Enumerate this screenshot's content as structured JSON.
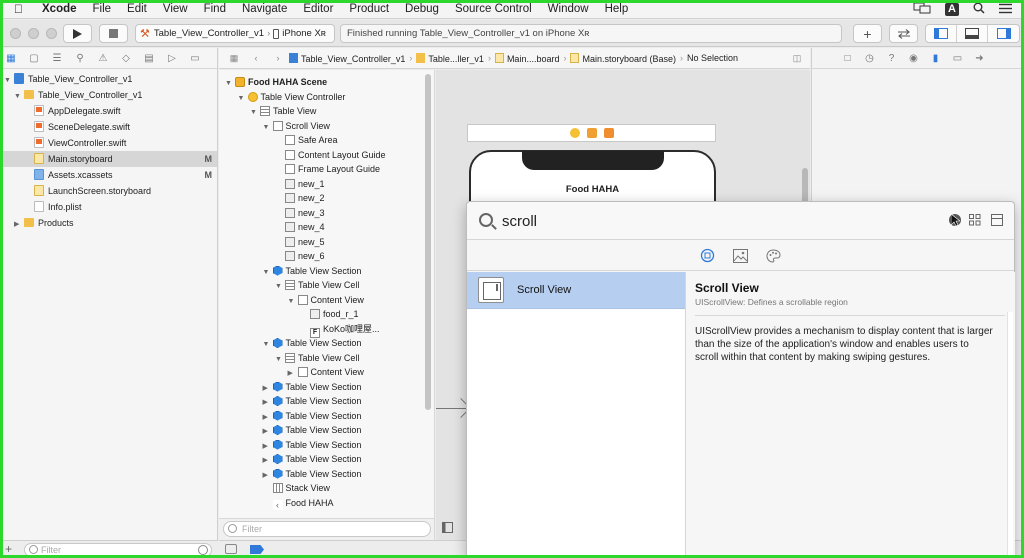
{
  "menubar": {
    "app": "Xcode",
    "items": [
      "File",
      "Edit",
      "View",
      "Find",
      "Navigate",
      "Editor",
      "Product",
      "Debug",
      "Source Control",
      "Window",
      "Help"
    ],
    "input_badge": "A"
  },
  "toolbar": {
    "scheme": "Table_View_Controller_v1",
    "destination": "iPhone Xʀ",
    "status": "Finished running Table_View_Controller_v1 on iPhone Xʀ"
  },
  "navigator": {
    "items": [
      {
        "label": "Table_View_Controller_v1",
        "mark": "",
        "icon": "project-icon"
      },
      {
        "label": "Table_View_Controller_v1",
        "mark": "",
        "icon": "folder-icon"
      },
      {
        "label": "AppDelegate.swift",
        "mark": "",
        "icon": "swift-file-icon"
      },
      {
        "label": "SceneDelegate.swift",
        "mark": "",
        "icon": "swift-file-icon"
      },
      {
        "label": "ViewController.swift",
        "mark": "",
        "icon": "swift-file-icon"
      },
      {
        "label": "Main.storyboard",
        "mark": "M",
        "icon": "storyboard-file-icon"
      },
      {
        "label": "Assets.xcassets",
        "mark": "M",
        "icon": "assets-catalog-icon"
      },
      {
        "label": "LaunchScreen.storyboard",
        "mark": "",
        "icon": "storyboard-file-icon"
      },
      {
        "label": "Info.plist",
        "mark": "",
        "icon": "plist-file-icon"
      },
      {
        "label": "Products",
        "mark": "",
        "icon": "folder-icon"
      }
    ],
    "filter_placeholder": "Filter"
  },
  "pathbar": {
    "crumbs": [
      "Table_View_Controller_v1",
      "Table...ller_v1",
      "Main....board",
      "Main.storyboard (Base)",
      "No Selection"
    ]
  },
  "outline": {
    "rows": [
      {
        "label": "Food HAHA Scene",
        "bold": true
      },
      {
        "label": "Table View Controller"
      },
      {
        "label": "Table View"
      },
      {
        "label": "Scroll View"
      },
      {
        "label": "Safe Area"
      },
      {
        "label": "Content Layout Guide"
      },
      {
        "label": "Frame Layout Guide"
      },
      {
        "label": "new_1"
      },
      {
        "label": "new_2"
      },
      {
        "label": "new_3"
      },
      {
        "label": "new_4"
      },
      {
        "label": "new_5"
      },
      {
        "label": "new_6"
      },
      {
        "label": "Table View Section"
      },
      {
        "label": "Table View Cell"
      },
      {
        "label": "Content View"
      },
      {
        "label": "food_r_1"
      },
      {
        "label": "KoKo咖哩屋..."
      },
      {
        "label": "Table View Section"
      },
      {
        "label": "Table View Cell"
      },
      {
        "label": "Content View"
      },
      {
        "label": "Table View Section"
      },
      {
        "label": "Table View Section"
      },
      {
        "label": "Table View Section"
      },
      {
        "label": "Table View Section"
      },
      {
        "label": "Table View Section"
      },
      {
        "label": "Table View Section"
      },
      {
        "label": "Table View Section"
      },
      {
        "label": "Stack View"
      },
      {
        "label": "Food HAHA"
      }
    ],
    "filter_placeholder": "Filter",
    "label_icon_glyph": "F"
  },
  "canvas": {
    "nav_title": "Food HAHA"
  },
  "library": {
    "search_value": "scroll",
    "items": [
      {
        "name": "Scroll View"
      }
    ],
    "detail": {
      "title": "Scroll View",
      "subtitle": "UIScrollView: Defines a scrollable region",
      "description": "UIScrollView provides a mechanism to display content that is larger than the size of the application's window and enables users to scroll within that content by making swiping gestures."
    }
  },
  "colors": {
    "accent": "#2f7ad9",
    "selection": "#b6cff0",
    "frame": "#2dd82d"
  }
}
